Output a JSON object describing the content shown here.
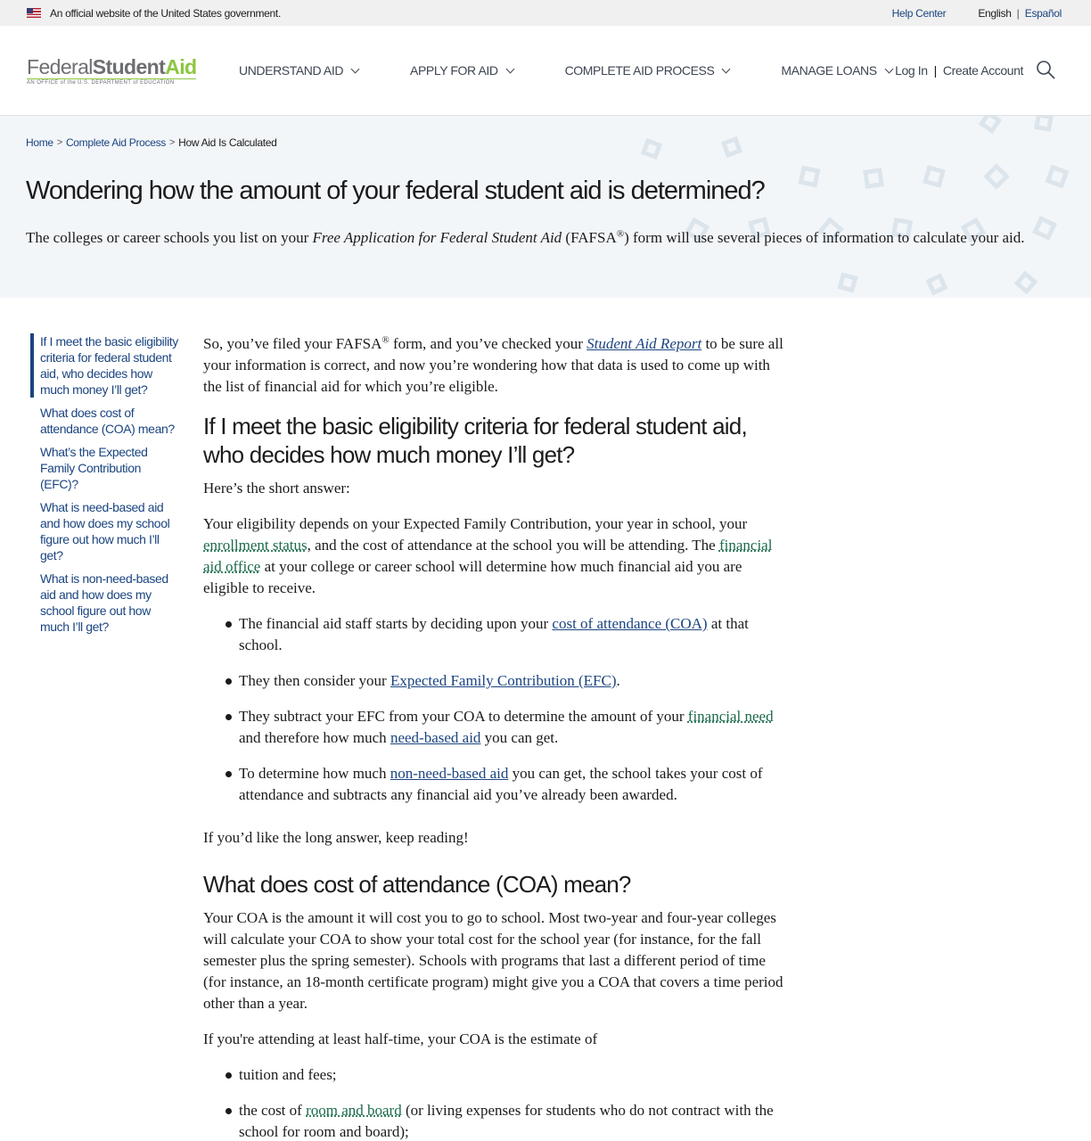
{
  "gov_banner": {
    "text": "An official website of the United States government.",
    "help_center": "Help Center",
    "lang_current": "English",
    "lang_separator": "|",
    "lang_alt": "Español"
  },
  "header": {
    "logo_federal": "Federal",
    "logo_student": "Student",
    "logo_aid": "Aid",
    "logo_sub": "AN OFFICE of the U.S. DEPARTMENT of EDUCATION",
    "nav": [
      "UNDERSTAND AID",
      "APPLY FOR AID",
      "COMPLETE AID PROCESS",
      "MANAGE LOANS"
    ],
    "login": "Log In",
    "account_separator": "|",
    "create_account": "Create Account",
    "search_icon": "search-icon"
  },
  "breadcrumb": {
    "home": "Home",
    "parent": "Complete Aid Process",
    "current": "How Aid Is Calculated",
    "separator": ">"
  },
  "hero": {
    "title": "Wondering how the amount of your federal student aid is determined?",
    "intro_1": "The colleges or career schools you list on your ",
    "intro_italic": "Free Application for Federal Student Aid",
    "intro_2": " (FAFSA",
    "intro_sup": "®",
    "intro_3": ") form will use several pieces of information to calculate your aid."
  },
  "side_nav": [
    "If I meet the basic eligibility criteria for federal student aid, who decides how much money I’ll get?",
    "What does cost of attendance (COA) mean?",
    "What’s the Expected Family Contribution (EFC)?",
    "What is need-based aid and how does my school figure out how much I’ll get?",
    "What is non-need-based aid and how does my school figure out how much I’ll get?"
  ],
  "article": {
    "p1_a": "So, you’ve filed your FAFSA",
    "p1_sup": "®",
    "p1_b": " form, and you’ve checked your ",
    "p1_link": "Student Aid Report",
    "p1_c": " to be sure all your information is correct, and now you’re wondering how that data is used to come up with the list of financial aid for which you’re eligible.",
    "h2_1": "If I meet the basic eligibility criteria for federal student aid, who decides how much money I’ll get?",
    "p2": "Here’s the short answer:",
    "p3_a": "Your eligibility depends on your Expected Family Contribution, your year in school, your ",
    "p3_link1": "enrollment status",
    "p3_b": ", and the cost of attendance at the school you will be attending. The ",
    "p3_link2": "financial aid office",
    "p3_c": " at your college or career school will determine how much financial aid you are eligible to receive.",
    "li1_a": "The financial aid staff starts by deciding upon your ",
    "li1_link": "cost of attendance (COA)",
    "li1_b": " at that school.",
    "li2_a": "They then consider your ",
    "li2_link": "Expected Family Contribution (EFC)",
    "li2_b": ".",
    "li3_a": "They subtract your EFC from your COA to determine the amount of your ",
    "li3_link1": "financial need",
    "li3_b": " and therefore how much ",
    "li3_link2": "need-based aid",
    "li3_c": " you can get.",
    "li4_a": "To determine how much ",
    "li4_link": "non-need-based aid",
    "li4_b": " you can get, the school takes your cost of attendance and subtracts any financial aid you’ve already been awarded.",
    "p4": "If you’d like the long answer, keep reading!",
    "h2_2": "What does cost of attendance (COA) mean?",
    "p5": "Your COA is the amount it will cost you to go to school. Most two-year and four-year colleges will calculate your COA to show your total cost for the school year (for instance, for the fall semester plus the spring semester). Schools with programs that last a different period of time (for instance, an 18-month certificate program) might give you a COA that covers a time period other than a year.",
    "p6": "If you're attending at least half-time, your COA is the estimate of",
    "li5": "tuition and fees;",
    "li6_a": "the cost of ",
    "li6_link": "room and board",
    "li6_b": " (or living expenses for students who do not contract with the school for room and board);"
  }
}
